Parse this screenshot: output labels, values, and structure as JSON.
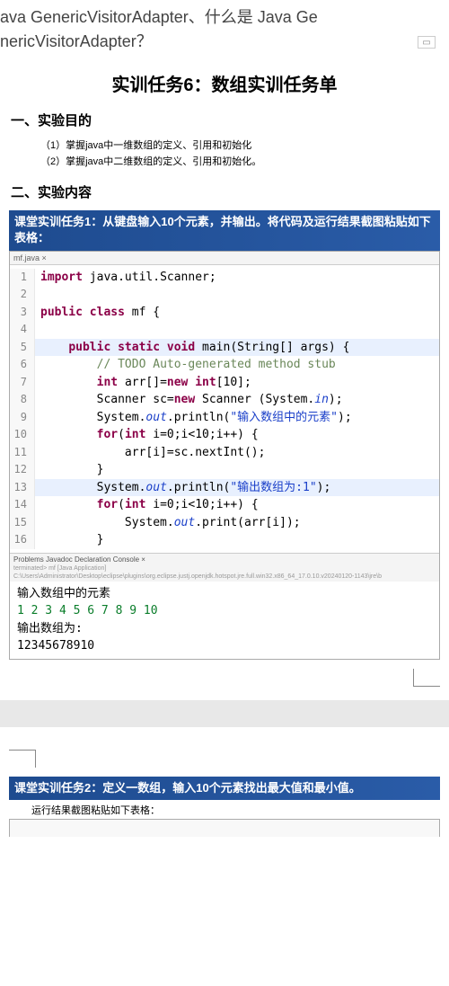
{
  "header": {
    "line1": "ava GenericVisitorAdapter、什么是 Java Ge",
    "line2": "nericVisitorAdapter？"
  },
  "doc": {
    "title": "实训任务6：数组实训任务单",
    "section1_heading": "一、实验目的",
    "objectives": [
      "（1）掌握java中一维数组的定义、引用和初始化",
      "（2）掌握java中二维数组的定义、引用和初始化。"
    ],
    "section2_heading": "二、实验内容"
  },
  "task1": {
    "banner": "课堂实训任务1：从键盘输入10个元素，并输出。将代码及运行结果截图粘贴如下表格：",
    "tab": "mf.java ×",
    "code": [
      {
        "n": "1",
        "pre": "",
        "seg": [
          [
            "kw",
            "import"
          ],
          [
            "",
            ""
          ],
          [
            "",
            "java.util.Scanner;"
          ]
        ]
      },
      {
        "n": "2",
        "pre": "",
        "seg": [
          [
            "",
            ""
          ]
        ]
      },
      {
        "n": "3",
        "pre": "",
        "seg": [
          [
            "kw",
            "public class"
          ],
          [
            "",
            ""
          ],
          [
            "",
            "mf {"
          ]
        ]
      },
      {
        "n": "4",
        "pre": "",
        "seg": [
          [
            "",
            ""
          ]
        ]
      },
      {
        "n": "5",
        "pre": "    ",
        "seg": [
          [
            "kw",
            "public static void"
          ],
          [
            "",
            ""
          ],
          [
            "",
            "main(String[] args) {"
          ]
        ],
        "hl": true
      },
      {
        "n": "6",
        "pre": "        ",
        "seg": [
          [
            "comment",
            "// TODO Auto-generated method stub"
          ]
        ]
      },
      {
        "n": "7",
        "pre": "        ",
        "seg": [
          [
            "kw",
            "int"
          ],
          [
            "",
            ""
          ],
          [
            "",
            "arr[]="
          ],
          [
            "kw",
            "new"
          ],
          [
            "",
            ""
          ],
          [
            "kw",
            "int"
          ],
          [
            "",
            "[10];"
          ]
        ]
      },
      {
        "n": "8",
        "pre": "        ",
        "seg": [
          [
            "",
            "Scanner sc="
          ],
          [
            "kw",
            "new"
          ],
          [
            "",
            ""
          ],
          [
            "",
            "Scanner (System."
          ],
          [
            "it",
            "in"
          ],
          [
            "",
            ");"
          ]
        ]
      },
      {
        "n": "9",
        "pre": "        ",
        "seg": [
          [
            "",
            "System."
          ],
          [
            "it",
            "out"
          ],
          [
            "",
            ".println("
          ],
          [
            "str",
            "\"输入数组中的元素\""
          ],
          [
            "",
            ");"
          ]
        ]
      },
      {
        "n": "10",
        "pre": "        ",
        "seg": [
          [
            "kw",
            "for"
          ],
          [
            "",
            "("
          ],
          [
            "kw",
            "int"
          ],
          [
            "",
            ""
          ],
          [
            "",
            "i=0;i<10;i++) {"
          ]
        ]
      },
      {
        "n": "11",
        "pre": "            ",
        "seg": [
          [
            "",
            "arr[i]=sc.nextInt();"
          ]
        ]
      },
      {
        "n": "12",
        "pre": "        ",
        "seg": [
          [
            "",
            "}"
          ]
        ]
      },
      {
        "n": "13",
        "pre": "        ",
        "seg": [
          [
            "",
            "System."
          ],
          [
            "it",
            "out"
          ],
          [
            "",
            ".println("
          ],
          [
            "str",
            "\"输出数组为:1\""
          ],
          [
            "",
            ");"
          ]
        ],
        "hl": true
      },
      {
        "n": "14",
        "pre": "        ",
        "seg": [
          [
            "kw",
            "for"
          ],
          [
            "",
            "("
          ],
          [
            "kw",
            "int"
          ],
          [
            "",
            ""
          ],
          [
            "",
            "i=0;i<10;i++) {"
          ]
        ]
      },
      {
        "n": "15",
        "pre": "            ",
        "seg": [
          [
            "",
            "System."
          ],
          [
            "it",
            "out"
          ],
          [
            "",
            ".print(arr[i]);"
          ]
        ]
      },
      {
        "n": "16",
        "pre": "        ",
        "seg": [
          [
            "",
            "}"
          ]
        ]
      }
    ],
    "console_tabs": "Problems  Javadoc  Declaration  Console ×",
    "console_terminated": "terminated> mf [Java Application] C:\\Users\\Administrator\\Desktop\\eclipse\\plugins\\org.eclipse.justj.openjdk.hotspot.jre.full.win32.x86_64_17.0.10.v20240120-1143\\jre\\b",
    "console_output": [
      {
        "t": "输入数组中的元素",
        "cls": ""
      },
      {
        "t": "1 2 3 4 5 6 7 8 9 10",
        "cls": "console-green"
      },
      {
        "t": "输出数组为:",
        "cls": ""
      },
      {
        "t": "12345678910",
        "cls": ""
      }
    ]
  },
  "task2": {
    "banner": "课堂实训任务2：定义一数组，输入10个元素找出最大值和最小值。",
    "subtitle": "运行结果截图粘贴如下表格："
  }
}
